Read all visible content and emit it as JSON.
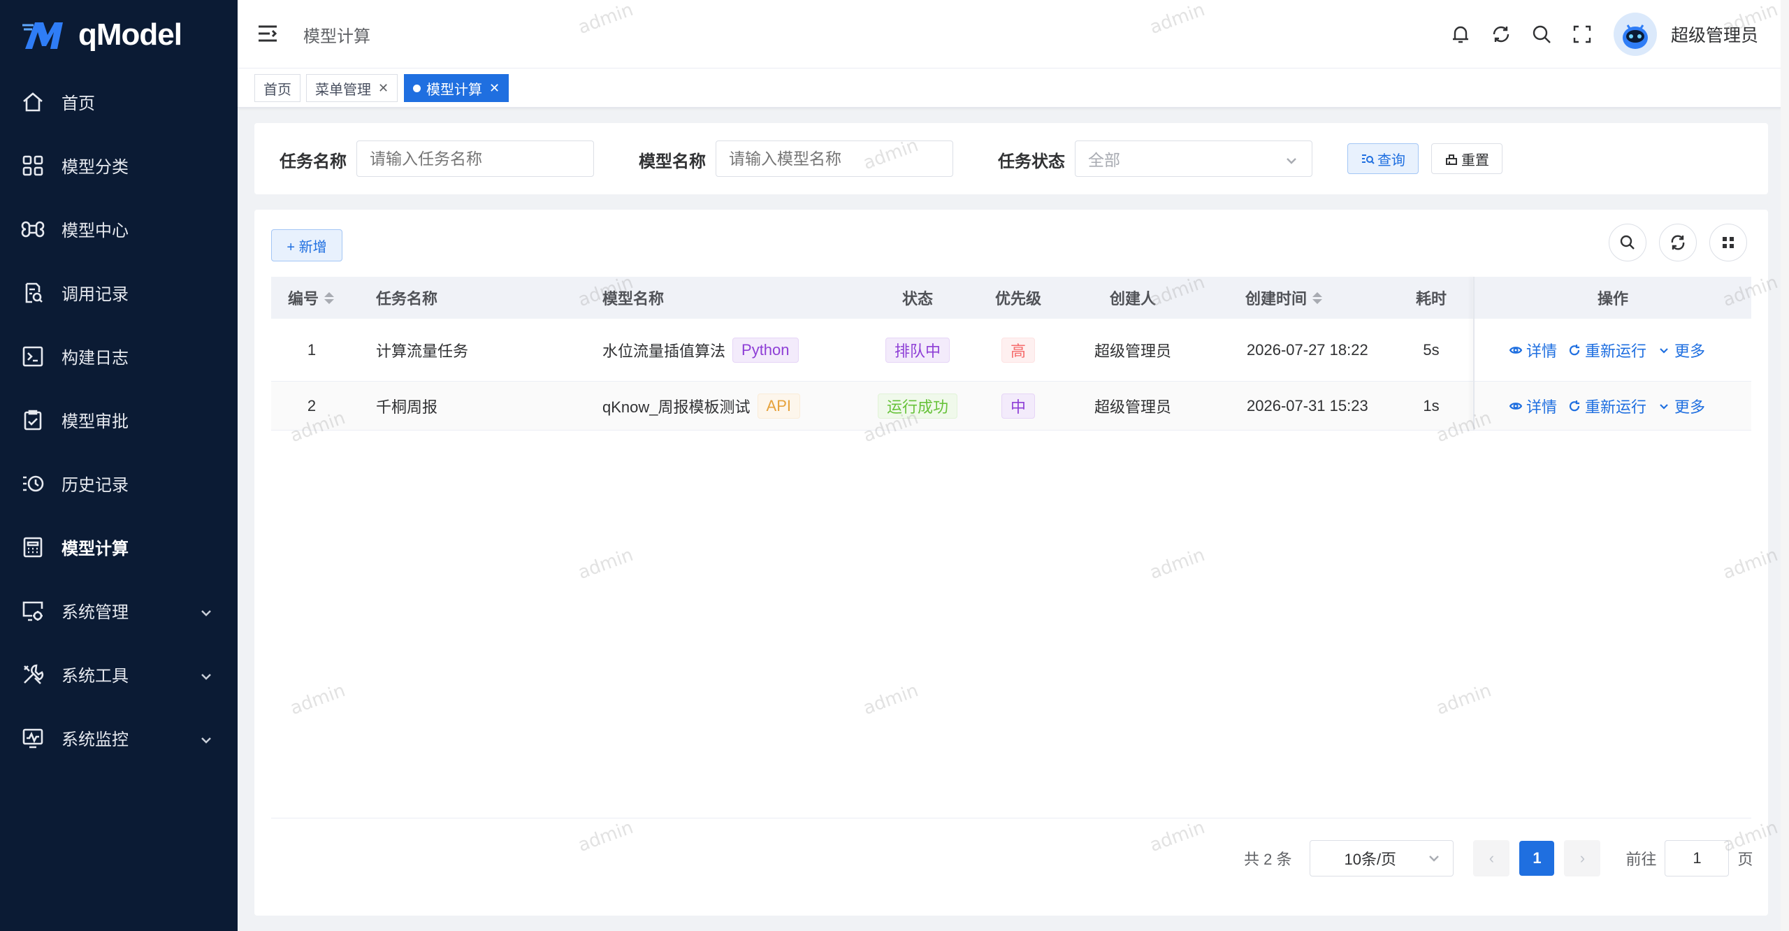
{
  "app": {
    "logo_text": "qModel"
  },
  "sidebar": {
    "items": [
      {
        "label": "首页",
        "icon": "home-icon",
        "active": false,
        "expandable": false
      },
      {
        "label": "模型分类",
        "icon": "grid-icon",
        "active": false,
        "expandable": false
      },
      {
        "label": "模型中心",
        "icon": "command-icon",
        "active": false,
        "expandable": false
      },
      {
        "label": "调用记录",
        "icon": "document-search-icon",
        "active": false,
        "expandable": false
      },
      {
        "label": "构建日志",
        "icon": "terminal-icon",
        "active": false,
        "expandable": false
      },
      {
        "label": "模型审批",
        "icon": "clipboard-check-icon",
        "active": false,
        "expandable": false
      },
      {
        "label": "历史记录",
        "icon": "history-list-icon",
        "active": false,
        "expandable": false
      },
      {
        "label": "模型计算",
        "icon": "calculator-icon",
        "active": true,
        "expandable": false
      },
      {
        "label": "系统管理",
        "icon": "monitor-settings-icon",
        "active": false,
        "expandable": true
      },
      {
        "label": "系统工具",
        "icon": "tools-icon",
        "active": false,
        "expandable": true
      },
      {
        "label": "系统监控",
        "icon": "monitor-chart-icon",
        "active": false,
        "expandable": true
      }
    ]
  },
  "header": {
    "breadcrumb": "模型计算",
    "user_name": "超级管理员"
  },
  "tags": [
    {
      "label": "首页",
      "closable": false,
      "active": false
    },
    {
      "label": "菜单管理",
      "closable": true,
      "active": false
    },
    {
      "label": "模型计算",
      "closable": true,
      "active": true
    }
  ],
  "search": {
    "task_name_label": "任务名称",
    "task_name_placeholder": "请输入任务名称",
    "model_name_label": "模型名称",
    "model_name_placeholder": "请输入模型名称",
    "status_label": "任务状态",
    "status_value": "全部",
    "query_label": "查询",
    "reset_label": "重置"
  },
  "toolbar": {
    "add_label": "+ 新增"
  },
  "table": {
    "headers": {
      "id": "编号",
      "task_name": "任务名称",
      "model_name": "模型名称",
      "status": "状态",
      "priority": "优先级",
      "creator": "创建人",
      "created_at": "创建时间",
      "duration": "耗时",
      "actions": "操作"
    },
    "rows": [
      {
        "id": "1",
        "task_name": "计算流量任务",
        "model_name": "水位流量插值算法",
        "model_type": "Python",
        "status": "排队中",
        "priority": "高",
        "creator": "超级管理员",
        "created_at": "2026-07-27 18:22",
        "duration": "5s"
      },
      {
        "id": "2",
        "task_name": "千桐周报",
        "model_name": "qKnow_周报模板测试",
        "model_type": "API",
        "status": "运行成功",
        "priority": "中",
        "creator": "超级管理员",
        "created_at": "2026-07-31 15:23",
        "duration": "1s"
      }
    ],
    "actions": {
      "detail": "详情",
      "rerun": "重新运行",
      "more": "更多"
    }
  },
  "pagination": {
    "total_text": "共 2 条",
    "page_size": "10条/页",
    "current_page": "1",
    "goto_label": "前往",
    "goto_value": "1",
    "page_suffix": "页"
  },
  "watermark": "admin",
  "colors": {
    "sidebar_bg": "#0b1b34",
    "primary": "#1f6fe0"
  }
}
